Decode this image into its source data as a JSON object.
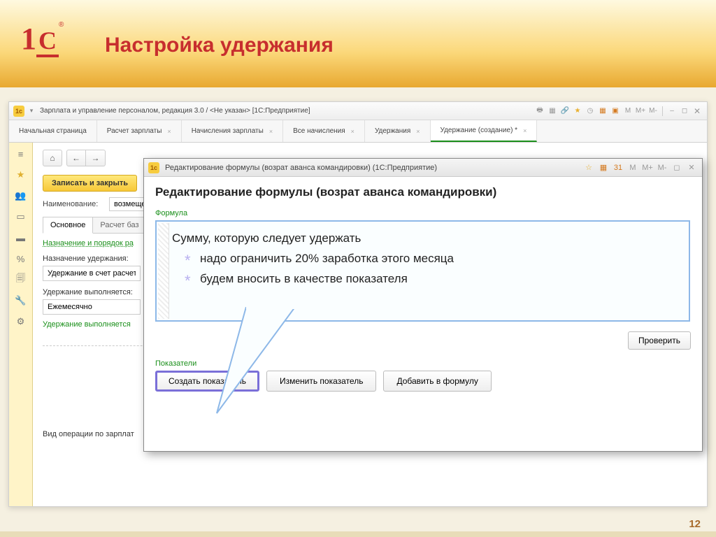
{
  "banner": {
    "title": "Настройка удержания",
    "logo_text1": "1",
    "logo_text2": "C",
    "reg": "®"
  },
  "app": {
    "title": "Зарплата и управление персоналом, редакция 3.0 / <Не указан>   [1С:Предприятие]",
    "memory_labels": {
      "m": "M",
      "mplus": "M+",
      "mminus": "M-"
    },
    "tabs": [
      {
        "label": "Начальная страница"
      },
      {
        "label": "Расчет зарплаты"
      },
      {
        "label": "Начисления зарплаты"
      },
      {
        "label": "Все начисления"
      },
      {
        "label": "Удержания"
      },
      {
        "label": "Удержание (создание) *",
        "active": true
      }
    ],
    "sidebar_icons": [
      "≡",
      "★",
      "👥",
      "▭",
      "▬",
      "%",
      "🗐",
      "🔧",
      "⚙"
    ],
    "save_button": "Записать и закрыть",
    "field_name_label": "Наименование:",
    "field_name_value": "возмещен",
    "subtabs": [
      {
        "label": "Основное",
        "active": true
      },
      {
        "label": "Расчет баз"
      }
    ],
    "green1": "Назначение и порядок ра",
    "purpose_label": "Назначение удержания:",
    "purpose_value": "Удержание в счет расчет",
    "exec_label": "Удержание выполняется:",
    "exec_value": "Ежемесячно",
    "exec2": "Удержание выполняется",
    "op_label": "Вид операции по зарплат"
  },
  "dialog": {
    "titlebar": "Редактирование формулы (возрат аванса командировки)  (1С:Предприятие)",
    "memory_labels": {
      "m": "M",
      "mplus": "M+",
      "mminus": "M-"
    },
    "heading": "Редактирование формулы (возрат аванса командировки)",
    "formula_label": "Формула",
    "annot1": "Сумму, которую следует удержать",
    "annot2": "надо ограничить 20% заработка этого месяца",
    "annot3": "будем вносить в качестве показателя",
    "check_btn": "Проверить",
    "indicators_label": "Показатели",
    "btn_create": "Создать показатель",
    "btn_edit": "Изменить показатель",
    "btn_add": "Добавить в формулу"
  },
  "page_number": "12"
}
